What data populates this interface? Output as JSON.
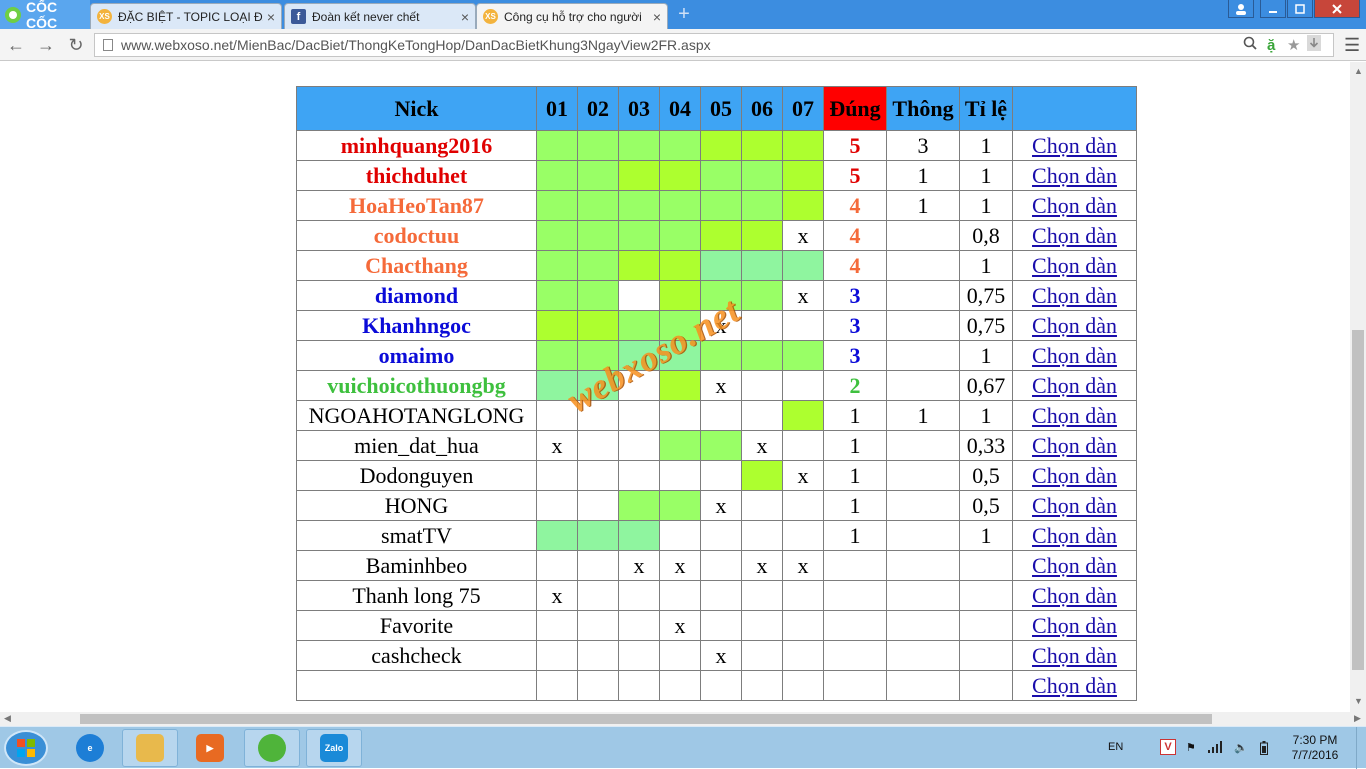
{
  "browser": {
    "brand": "CỐC CỐC",
    "tabs": [
      {
        "label": "ĐẶC BIỆT - TOPIC LOẠI ĐẶ",
        "favicon": "XS",
        "active": false
      },
      {
        "label": "Đoàn kết never chết",
        "favicon": "f",
        "active": false
      },
      {
        "label": "Công cụ hỗ trợ cho người",
        "favicon": "XS",
        "active": true
      }
    ],
    "new_tab": "+",
    "url": "www.webxoso.net/MienBac/DacBiet/ThongKeTongHop/DanDacBietKhung3NgayView2FR.aspx"
  },
  "table": {
    "headers": {
      "nick": "Nick",
      "days": [
        "01",
        "02",
        "03",
        "04",
        "05",
        "06",
        "07"
      ],
      "dung": "Đúng",
      "thong": "Thông",
      "tile": "Tỉ lệ",
      "action": ""
    },
    "action_label": "Chọn dàn",
    "rows": [
      {
        "nick": "minhquang2016",
        "style": "red",
        "days": [
          "c1",
          "c1",
          "c1",
          "c1",
          "c2",
          "c2",
          "c2"
        ],
        "dung": "5",
        "thong": "3",
        "tile": "1"
      },
      {
        "nick": "thichduhet",
        "style": "red",
        "days": [
          "c1",
          "c1",
          "c2",
          "c2",
          "c1",
          "c1",
          "c2"
        ],
        "dung": "5",
        "thong": "1",
        "tile": "1"
      },
      {
        "nick": "HoaHeoTan87",
        "style": "orange",
        "days": [
          "c1",
          "c1",
          "c1",
          "c1",
          "c1",
          "c1",
          "c2"
        ],
        "dung": "4",
        "thong": "1",
        "tile": "1"
      },
      {
        "nick": "codoctuu",
        "style": "orange",
        "days": [
          "c1",
          "c1",
          "c1",
          "c1",
          "c2",
          "c2",
          "x"
        ],
        "dung": "4",
        "thong": "",
        "tile": "0,8"
      },
      {
        "nick": "Chacthang",
        "style": "orange",
        "days": [
          "c1",
          "c1",
          "c2",
          "c2",
          "c3",
          "c3",
          "c3"
        ],
        "dung": "4",
        "thong": "",
        "tile": "1"
      },
      {
        "nick": "diamond",
        "style": "blue",
        "days": [
          "c1",
          "c1",
          "",
          "c2",
          "c1",
          "c1",
          "x"
        ],
        "dung": "3",
        "thong": "",
        "tile": "0,75"
      },
      {
        "nick": "Khanhngoc",
        "style": "blue",
        "days": [
          "c2",
          "c2",
          "c1",
          "c1",
          "x",
          "",
          ""
        ],
        "dung": "3",
        "thong": "",
        "tile": "0,75"
      },
      {
        "nick": "omaimo",
        "style": "blue",
        "days": [
          "c1",
          "c1",
          "c3",
          "c3",
          "c1",
          "c1",
          "c1"
        ],
        "dung": "3",
        "thong": "",
        "tile": "1"
      },
      {
        "nick": "vuichoicothuongbg",
        "style": "green",
        "days": [
          "c3",
          "c3",
          "",
          "c2",
          "x",
          "",
          ""
        ],
        "dung": "2",
        "thong": "",
        "tile": "0,67"
      },
      {
        "nick": "NGOAHOTANGLONG",
        "style": "plain",
        "days": [
          "",
          "",
          "",
          "",
          "",
          "",
          "c2"
        ],
        "dung": "1",
        "thong": "1",
        "tile": "1"
      },
      {
        "nick": "mien_dat_hua",
        "style": "plain",
        "days": [
          "x",
          "",
          "",
          "c1",
          "c1",
          "x",
          ""
        ],
        "dung": "1",
        "thong": "",
        "tile": "0,33"
      },
      {
        "nick": "Dodonguyen",
        "style": "plain",
        "days": [
          "",
          "",
          "",
          "",
          "",
          "c2",
          "x"
        ],
        "dung": "1",
        "thong": "",
        "tile": "0,5"
      },
      {
        "nick": "HONG",
        "style": "plain",
        "days": [
          "",
          "",
          "c1",
          "c1",
          "x",
          "",
          ""
        ],
        "dung": "1",
        "thong": "",
        "tile": "0,5"
      },
      {
        "nick": "smatTV",
        "style": "plain",
        "days": [
          "c3",
          "c3",
          "c3",
          "",
          "",
          "",
          ""
        ],
        "dung": "1",
        "thong": "",
        "tile": "1"
      },
      {
        "nick": "Baminhbeo",
        "style": "plain",
        "days": [
          "",
          "",
          "x",
          "x",
          "",
          "x",
          "x"
        ],
        "dung": "",
        "thong": "",
        "tile": ""
      },
      {
        "nick": "Thanh long 75",
        "style": "plain",
        "days": [
          "x",
          "",
          "",
          "",
          "",
          "",
          ""
        ],
        "dung": "",
        "thong": "",
        "tile": ""
      },
      {
        "nick": "Favorite",
        "style": "plain",
        "days": [
          "",
          "",
          "",
          "x",
          "",
          "",
          ""
        ],
        "dung": "",
        "thong": "",
        "tile": ""
      },
      {
        "nick": "cashcheck",
        "style": "plain",
        "days": [
          "",
          "",
          "",
          "",
          "x",
          "",
          ""
        ],
        "dung": "",
        "thong": "",
        "tile": ""
      },
      {
        "nick": "",
        "style": "plain",
        "days": [
          "",
          "",
          "",
          "",
          "",
          "",
          ""
        ],
        "dung": "",
        "thong": "",
        "tile": ""
      }
    ]
  },
  "watermark": "webxoso.net",
  "taskbar": {
    "apps": [
      "explorer",
      "media",
      "coccoc",
      "Zalo"
    ],
    "lang": "EN",
    "time": "7:30 PM",
    "date": "7/7/2016"
  },
  "colors": {
    "header_blue": "#3ea4f4",
    "dung_red": "#ff0000",
    "cell_green_1": "#99ff66",
    "cell_green_2": "#adff2f",
    "cell_green_3": "#8ff59f"
  }
}
